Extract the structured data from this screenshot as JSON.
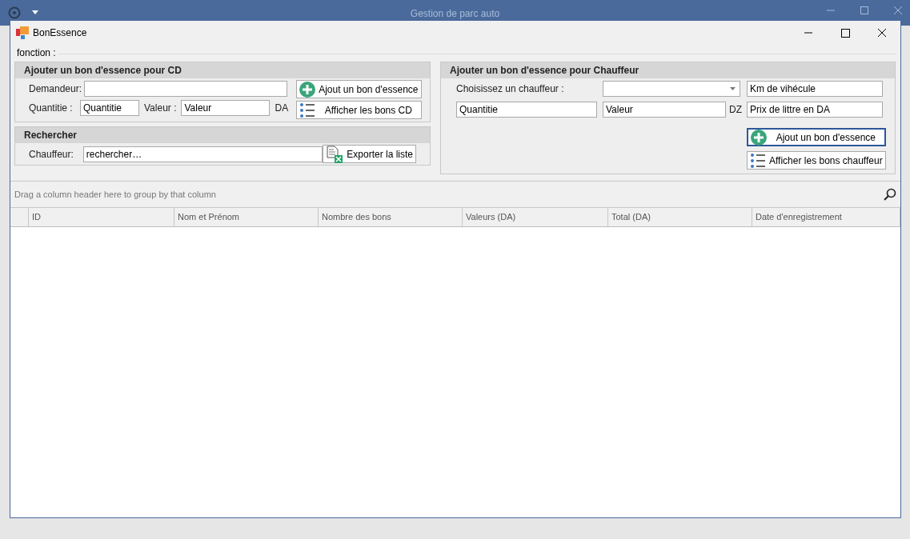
{
  "app_window": {
    "title": "Gestion de parc auto"
  },
  "window": {
    "title": "BonEssence"
  },
  "group_title": "fonction :",
  "cd_panel": {
    "title": "Ajouter un bon d'essence pour CD",
    "demandeur_label": "Demandeur:",
    "quantite_label": "Quantitie :",
    "quantite_value": "Quantitie",
    "valeur_label": "Valeur :",
    "valeur_value": "Valeur",
    "unit": "DA",
    "add_button": "Ajout un bon d'essence",
    "list_button": "Afficher les bons CD"
  },
  "search_panel": {
    "title": "Rechercher",
    "label": "Chauffeur:",
    "value": "rechercher…",
    "export_button": "Exporter la liste"
  },
  "driver_panel": {
    "title": "Ajouter un bon d'essence pour Chauffeur",
    "choose_label": "Choisissez un chauffeur :",
    "km_value": "Km de vihécule",
    "quantite_value": "Quantitie",
    "valeur_value": "Valeur",
    "unit": "DZ",
    "prix_value": "Prix de littre en DA",
    "add_button": "Ajout un bon d'essence",
    "list_button": "Afficher les bons chauffeur"
  },
  "grid": {
    "group_hint": "Drag a column header here to group by that column",
    "columns": [
      "ID",
      "Nom et Prénom",
      "Nombre des bons",
      "Valeurs (DA)",
      "Total (DA)",
      "Date d'enregistrement"
    ]
  }
}
